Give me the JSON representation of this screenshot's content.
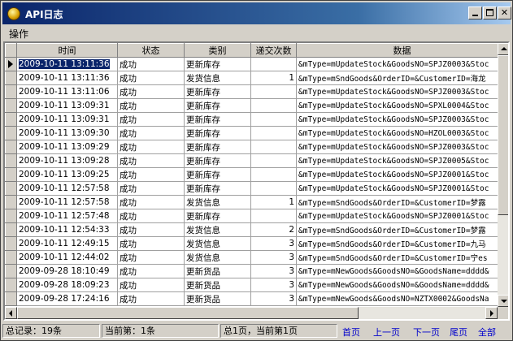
{
  "window": {
    "title": "API日志"
  },
  "menu": {
    "operate": "操作"
  },
  "grid": {
    "columns": [
      "时间",
      "状态",
      "类别",
      "递交次数",
      "数据"
    ],
    "rows": [
      [
        "2009-10-11 13:11:36",
        "成功",
        "更新库存",
        "",
        "&mType=mUpdateStock&GoodsNO=SPJZ0003&Stoc"
      ],
      [
        "2009-10-11 13:11:36",
        "成功",
        "发货信息",
        "1",
        "&mType=mSndGoods&OrderID=&CustomerID=海龙"
      ],
      [
        "2009-10-11 13:11:06",
        "成功",
        "更新库存",
        "",
        "&mType=mUpdateStock&GoodsNO=SPJZ0003&Stoc"
      ],
      [
        "2009-10-11 13:09:31",
        "成功",
        "更新库存",
        "",
        "&mType=mUpdateStock&GoodsNO=SPXL0004&Stoc"
      ],
      [
        "2009-10-11 13:09:31",
        "成功",
        "更新库存",
        "",
        "&mType=mUpdateStock&GoodsNO=SPJZ0003&Stoc"
      ],
      [
        "2009-10-11 13:09:30",
        "成功",
        "更新库存",
        "",
        "&mType=mUpdateStock&GoodsNO=HZOL0003&Stoc"
      ],
      [
        "2009-10-11 13:09:29",
        "成功",
        "更新库存",
        "",
        "&mType=mUpdateStock&GoodsNO=SPJZ0003&Stoc"
      ],
      [
        "2009-10-11 13:09:28",
        "成功",
        "更新库存",
        "",
        "&mType=mUpdateStock&GoodsNO=SPJZ0005&Stoc"
      ],
      [
        "2009-10-11 13:09:25",
        "成功",
        "更新库存",
        "",
        "&mType=mUpdateStock&GoodsNO=SPJZ0001&Stoc"
      ],
      [
        "2009-10-11 12:57:58",
        "成功",
        "更新库存",
        "",
        "&mType=mUpdateStock&GoodsNO=SPJZ0001&Stoc"
      ],
      [
        "2009-10-11 12:57:58",
        "成功",
        "发货信息",
        "1",
        "&mType=mSndGoods&OrderID=&CustomerID=梦露"
      ],
      [
        "2009-10-11 12:57:48",
        "成功",
        "更新库存",
        "",
        "&mType=mUpdateStock&GoodsNO=SPJZ0001&Stoc"
      ],
      [
        "2009-10-11 12:54:33",
        "成功",
        "发货信息",
        "2",
        "&mType=mSndGoods&OrderID=&CustomerID=梦露"
      ],
      [
        "2009-10-11 12:49:15",
        "成功",
        "发货信息",
        "3",
        "&mType=mSndGoods&OrderID=&CustomerID=九马"
      ],
      [
        "2009-10-11 12:44:02",
        "成功",
        "发货信息",
        "3",
        "&mType=mSndGoods&OrderID=&CustomerID=宁es"
      ],
      [
        "2009-09-28 18:10:49",
        "成功",
        "更新货品",
        "3",
        "&mType=mNewGoods&GoodsNO=&GoodsName=dddd&"
      ],
      [
        "2009-09-28 18:09:23",
        "成功",
        "更新货品",
        "3",
        "&mType=mNewGoods&GoodsNO=&GoodsName=dddd&"
      ],
      [
        "2009-09-28 17:24:16",
        "成功",
        "更新货品",
        "3",
        "&mType=mNewGoods&GoodsNO=NZTX0002&GoodsNa"
      ]
    ]
  },
  "status": {
    "total": "总记录：19条",
    "current": "当前第：1条",
    "pages": "总1页，当前第1页",
    "first": "首页",
    "prev": "上一页",
    "next": "下一页",
    "last": "尾页",
    "all": "全部"
  }
}
